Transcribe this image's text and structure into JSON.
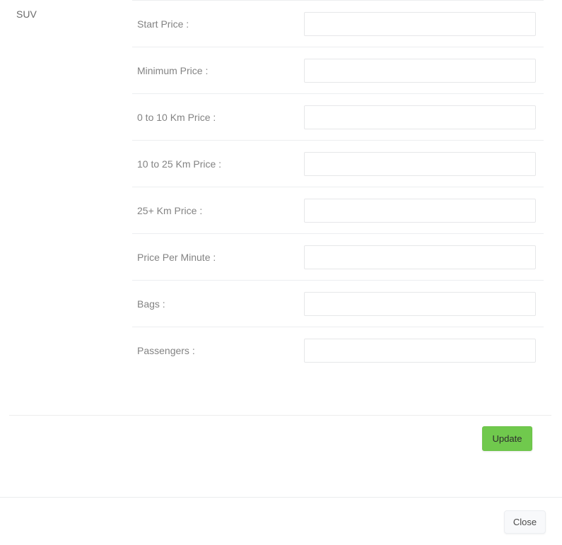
{
  "vehicle": {
    "type_label": "SUV"
  },
  "form": {
    "fields": [
      {
        "label": "Start Price :",
        "value": "",
        "placeholder": "",
        "name": "start-price"
      },
      {
        "label": "Minimum Price :",
        "value": "",
        "placeholder": "",
        "name": "minimum-price"
      },
      {
        "label": "0 to 10 Km Price :",
        "value": "",
        "placeholder": "",
        "name": "0-to-10-km-price"
      },
      {
        "label": "10 to 25 Km Price :",
        "value": "",
        "placeholder": "",
        "name": "10-to-25-km-price"
      },
      {
        "label": "25+ Km Price :",
        "value": "",
        "placeholder": "",
        "name": "25-plus-km-price"
      },
      {
        "label": "Price Per Minute :",
        "value": "",
        "placeholder": "",
        "name": "price-per-minute"
      },
      {
        "label": "Bags :",
        "value": "",
        "placeholder": "",
        "name": "bags"
      },
      {
        "label": "Passengers :",
        "value": "",
        "placeholder": "",
        "name": "passengers"
      }
    ]
  },
  "actions": {
    "update_label": "Update",
    "close_label": "Close"
  },
  "colors": {
    "update_button_bg": "#70c94d",
    "update_button_text": "#2d2d2d",
    "close_button_bg": "#f8f9fb",
    "close_button_text": "#4a4a4a",
    "label_text": "#838383",
    "divider": "#eceef0",
    "input_border": "#e6e7e9",
    "page_bg": "#ffffff"
  }
}
